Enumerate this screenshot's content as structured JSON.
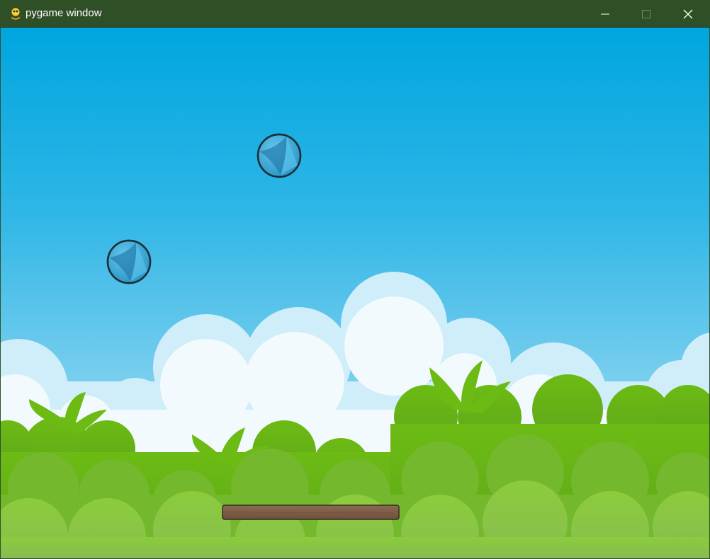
{
  "window": {
    "title": "pygame window",
    "app_icon": "pygame-snake-icon",
    "controls": {
      "minimize_icon": "minimize-icon",
      "maximize_icon": "maximize-icon",
      "close_icon": "close-icon"
    }
  },
  "game": {
    "background": {
      "sky_top": "#00a6e0",
      "sky_bottom": "#bfe8f7",
      "cloud": "#f2fafd",
      "cloud_shade": "#cfeef9",
      "grass_dark": "#68b81c",
      "grass_light": "#8bc34a"
    },
    "balls": [
      {
        "name": "ball-1",
        "color": "#3ab0dc"
      },
      {
        "name": "ball-2",
        "color": "#3ab0dc"
      }
    ],
    "paddle": {
      "color": "#7a5a44"
    }
  }
}
